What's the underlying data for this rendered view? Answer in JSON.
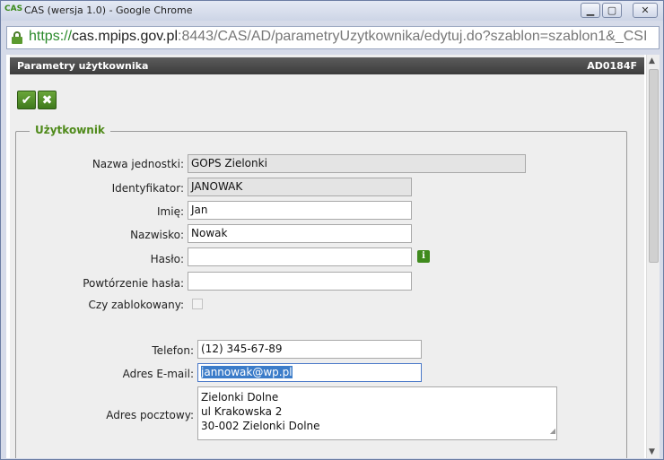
{
  "window": {
    "app_logo": "CAS",
    "title": "CAS (wersja 1.0) - Google Chrome",
    "min_glyph": "▁",
    "max_glyph": "▢",
    "close_glyph": "✕"
  },
  "address": {
    "scheme": "https://",
    "host": "cas.mpips.gov.pl",
    "rest": ":8443/CAS/AD/parametryUzytkownika/edytuj.do?szablon=szablon1&_CSI"
  },
  "header": {
    "title": "Parametry użytkownika",
    "code": "AD0184F"
  },
  "actions": {
    "ok_glyph": "✔",
    "cancel_glyph": "✖"
  },
  "panel": {
    "legend": "Użytkownik"
  },
  "fields": {
    "unit_label": "Nazwa jednostki:",
    "unit_value": "GOPS Zielonki",
    "identifier_label": "Identyfikator:",
    "identifier_value": "JANOWAK",
    "first_name_label": "Imię:",
    "first_name_value": "Jan",
    "last_name_label": "Nazwisko:",
    "last_name_value": "Nowak",
    "password_label": "Hasło:",
    "password_value": "",
    "password_repeat_label": "Powtórzenie hasła:",
    "password_repeat_value": "",
    "blocked_label": "Czy zablokowany:",
    "phone_label": "Telefon:",
    "phone_value": "(12) 345-67-89",
    "email_label": "Adres E-mail:",
    "email_value": "jannowak@wp.pl",
    "address_label": "Adres pocztowy:",
    "address_line1": "Zielonki Dolne",
    "address_line2": "ul Krakowska 2",
    "address_line3": "30-002 Zielonki Dolne"
  },
  "icons": {
    "info_glyph": "i"
  }
}
